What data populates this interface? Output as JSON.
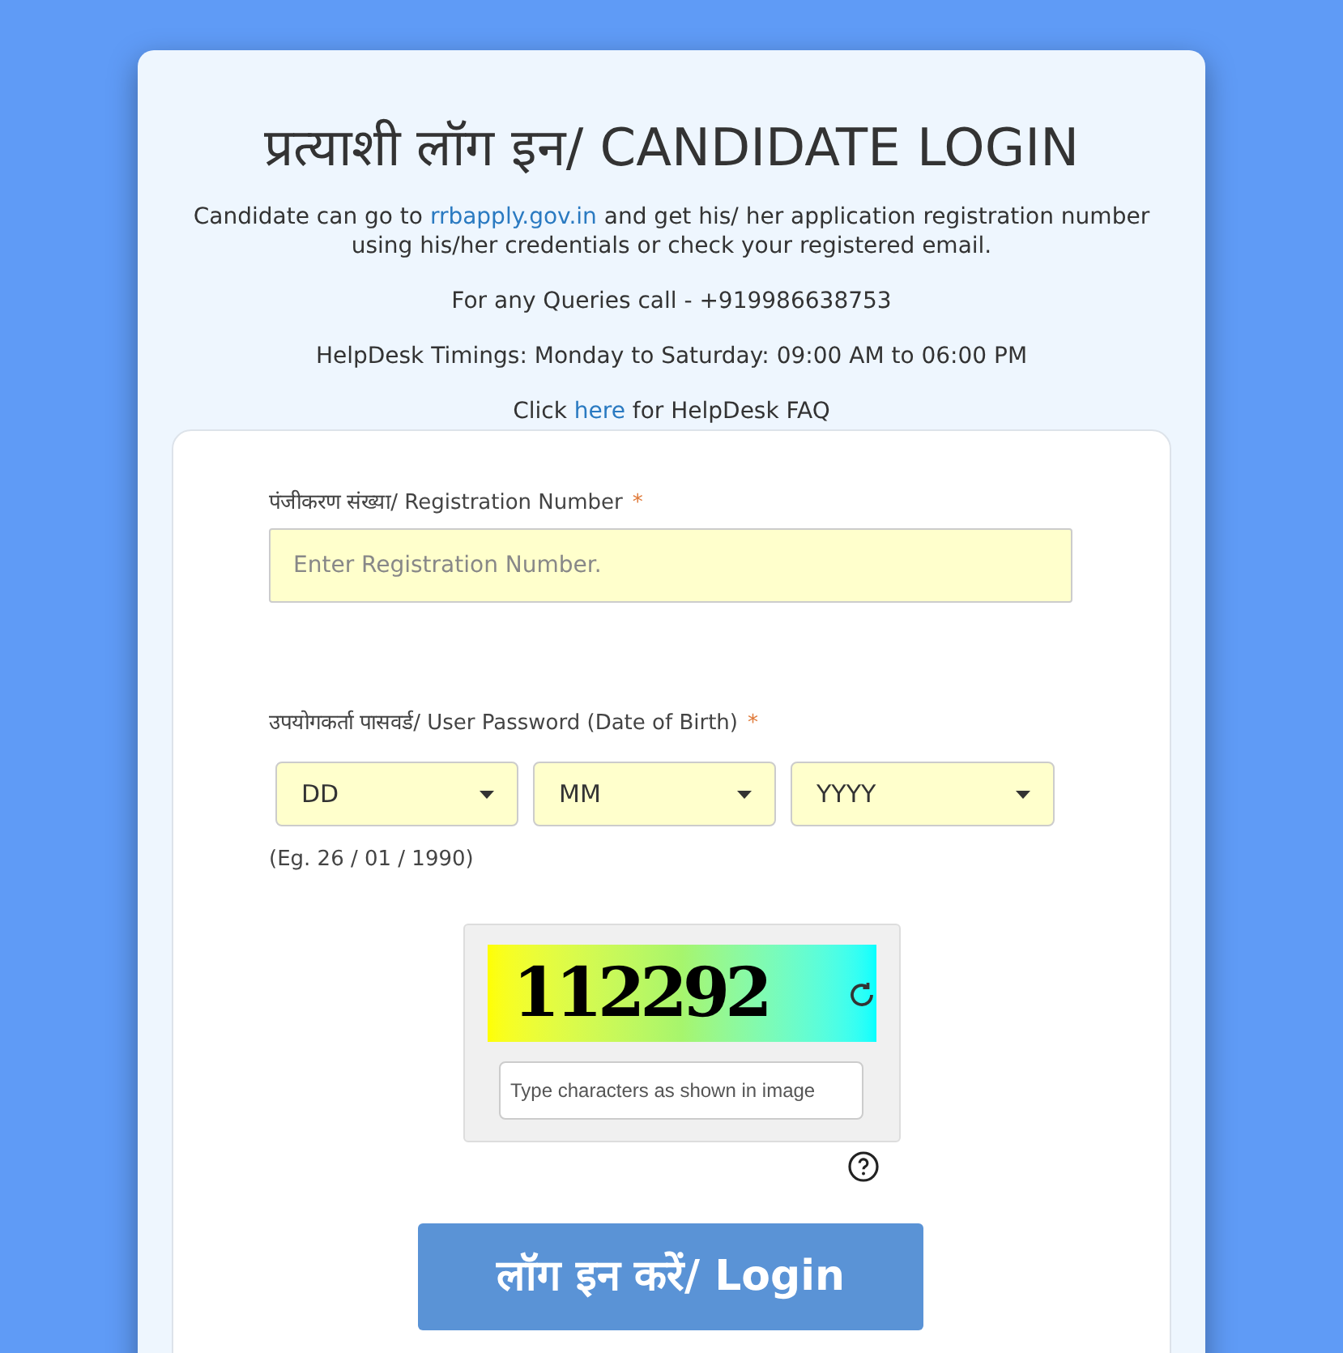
{
  "title": "प्रत्याशी लॉग इन/ CANDIDATE LOGIN",
  "intro": {
    "before": "Candidate can go to ",
    "link": "rrbapply.gov.in",
    "after": " and get his/ her application registration number using his/her credentials or check your registered email."
  },
  "queries": "For any Queries call - +919986638753",
  "timings": "HelpDesk Timings: Monday to Saturday: 09:00 AM to 06:00 PM",
  "faq": {
    "before": "Click ",
    "link": "here",
    "after": " for HelpDesk FAQ"
  },
  "registration": {
    "label": "पंजीकरण संख्या/ Registration Number",
    "required": "*",
    "placeholder": "Enter Registration Number."
  },
  "password": {
    "label": "उपयोगकर्ता पासवर्ड/ User Password (Date of Birth)",
    "required": "*",
    "selects": [
      {
        "value": "DD"
      },
      {
        "value": "MM"
      },
      {
        "value": "YYYY"
      }
    ],
    "example": "(Eg. 26 / 01 / 1990)"
  },
  "captcha": {
    "text": "112292",
    "placeholder": "Type characters as shown in image"
  },
  "login_button": "लॉग इन करें/ Login"
}
